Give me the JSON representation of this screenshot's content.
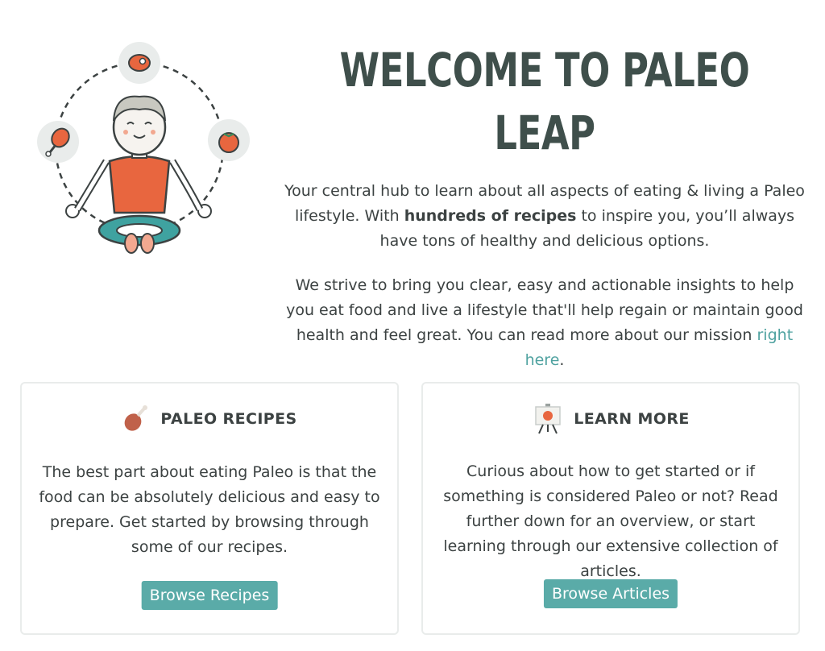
{
  "hero": {
    "title": "WELCOME TO PALEO LEAP",
    "p1_before": "Your central hub to learn about all aspects of eating & living a Paleo lifestyle. With ",
    "p1_bold": "hundreds of recipes",
    "p1_after": " to inspire you, you’ll always have tons of healthy and delicious options.",
    "p2_before": "We strive to bring you clear, easy and actionable insights to help you eat food and live a lifestyle that'll help regain or maintain good health and feel great. You can read more about our mission ",
    "p2_link": "right here",
    "p2_after": "."
  },
  "cards": {
    "recipes": {
      "title": "PALEO RECIPES",
      "text": "The best part about eating Paleo is that the food can be absolutely delicious and easy to prepare. Get started by browsing through some of our recipes.",
      "button": "Browse Recipes"
    },
    "learn": {
      "title": "LEARN MORE",
      "text": "Curious about how to get started or if something is considered Paleo or not? Read further down for an overview, or start learning through our extensive collection of articles.",
      "button": "Browse Articles"
    }
  },
  "colors": {
    "accent": "#5aaba8",
    "link": "#4fa2a0",
    "title": "#3f4f4b",
    "text": "#3c4242",
    "orange": "#e8663f",
    "teal_dark": "#2c6b69"
  }
}
